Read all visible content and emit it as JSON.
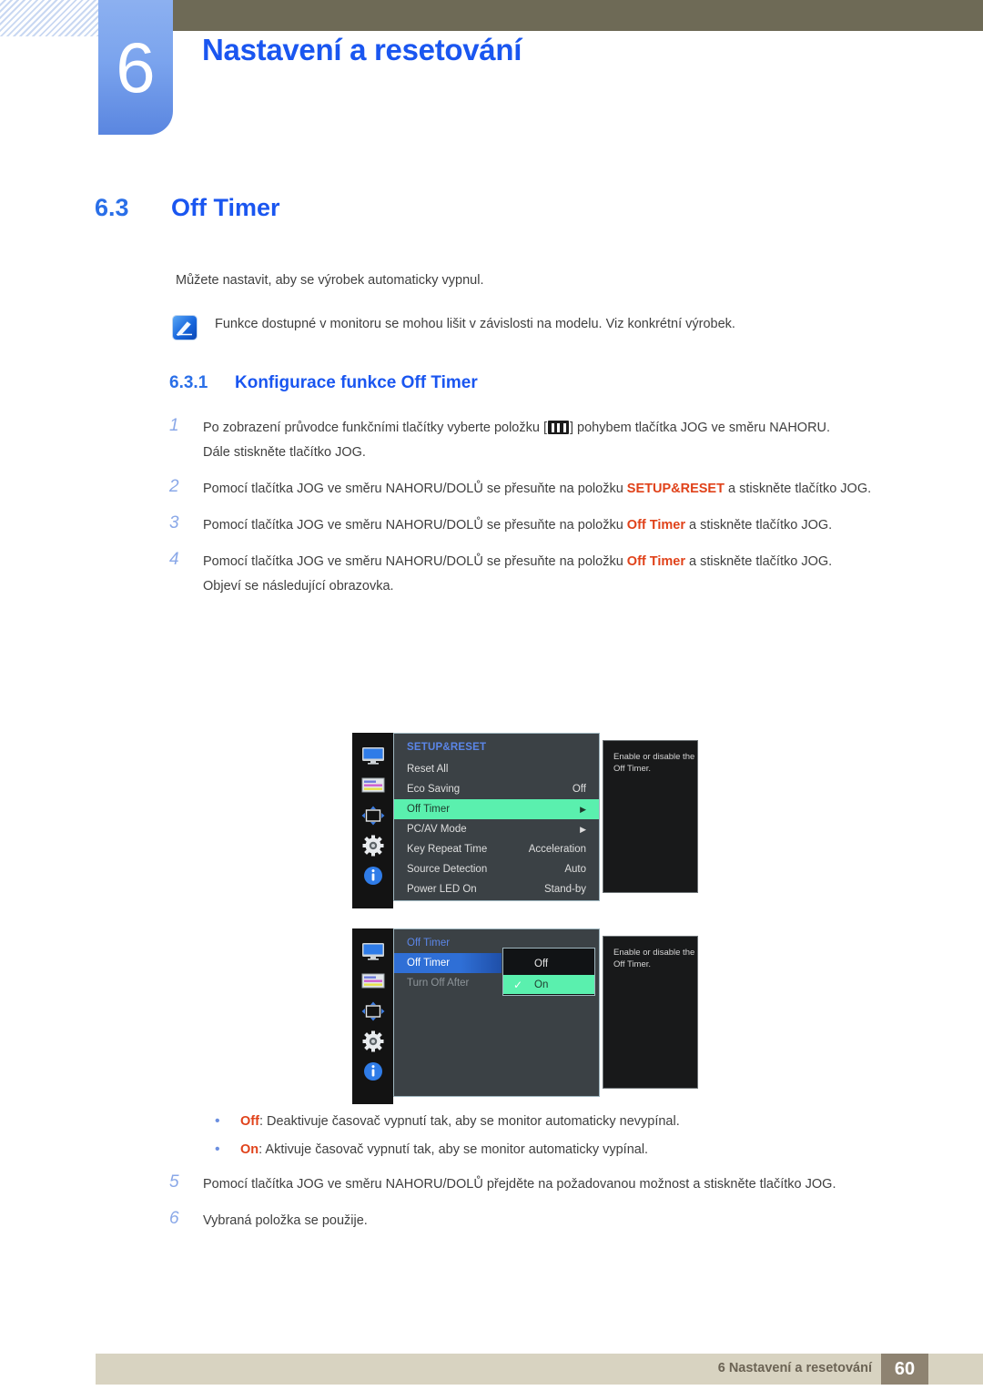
{
  "header": {
    "chapter_number": "6",
    "chapter_title": "Nastaveni a resetovani",
    "chapter_title_display": "Nastavení a resetování"
  },
  "section": {
    "number": "6.3",
    "title": "Off Timer"
  },
  "intro": "Můžete nastavit, aby se výrobek automaticky vypnul.",
  "note": {
    "icon": "note-pen-icon",
    "text": "Funkce dostupné v monitoru se mohou lišit v závislosti na modelu. Viz konkrétní výrobek."
  },
  "subsection": {
    "number": "6.3.1",
    "title": "Konfigurace funkce Off Timer"
  },
  "steps": [
    {
      "number": "1",
      "parts": [
        {
          "t": "Po zobrazení průvodce funkčními tlačítky vyberte položku [",
          "k": "plain"
        },
        {
          "t": "menu-glyph-icon",
          "k": "glyph"
        },
        {
          "t": "] pohybem tlačítka JOG ve směru NAHORU.",
          "k": "plain"
        }
      ],
      "extra": "Dále stiskněte tlačítko JOG."
    },
    {
      "number": "2",
      "parts": [
        {
          "t": "Pomocí tlačítka JOG ve směru NAHORU/DOLŮ se přesuňte na položku ",
          "k": "plain"
        },
        {
          "t": "SETUP&RESET",
          "k": "hl"
        },
        {
          "t": " a stiskněte tlačítko JOG.",
          "k": "plain"
        }
      ],
      "extra": ""
    },
    {
      "number": "3",
      "parts": [
        {
          "t": "Pomocí tlačítka JOG ve směru NAHORU/DOLŮ se přesuňte na položku ",
          "k": "plain"
        },
        {
          "t": "Off Timer",
          "k": "hl"
        },
        {
          "t": " a stiskněte tlačítko JOG.",
          "k": "plain"
        }
      ],
      "extra": ""
    },
    {
      "number": "4",
      "parts": [
        {
          "t": "Pomocí tlačítka JOG ve směru NAHORU/DOLŮ se přesuňte na položku ",
          "k": "plain"
        },
        {
          "t": "Off Timer",
          "k": "hl"
        },
        {
          "t": " a stiskněte tlačítko JOG.",
          "k": "plain"
        }
      ],
      "extra": "Objeví se následující obrazovka."
    }
  ],
  "osd_menu_1": {
    "title": "SETUP&RESET",
    "sidebar_icons": [
      "monitor-icon",
      "picture-list-icon",
      "position-arrows-icon",
      "gear-icon",
      "info-icon"
    ],
    "rows": [
      {
        "label": "Reset All",
        "value": "",
        "arrow": false,
        "selected": false
      },
      {
        "label": "Eco Saving",
        "value": "Off",
        "arrow": false,
        "selected": false
      },
      {
        "label": "Off Timer",
        "value": "",
        "arrow": true,
        "selected": true
      },
      {
        "label": "PC/AV Mode",
        "value": "",
        "arrow": true,
        "selected": false
      },
      {
        "label": "Key Repeat Time",
        "value": "Acceleration",
        "arrow": false,
        "selected": false
      },
      {
        "label": "Source Detection",
        "value": "Auto",
        "arrow": false,
        "selected": false
      },
      {
        "label": "Power LED On",
        "value": "Stand-by",
        "arrow": false,
        "selected": false
      }
    ],
    "description": "Enable or disable the Off Timer."
  },
  "osd_menu_2": {
    "title": "Off Timer",
    "sidebar_icons": [
      "monitor-icon",
      "picture-list-icon",
      "position-arrows-icon",
      "gear-icon",
      "info-icon"
    ],
    "rows": [
      {
        "label": "Off Timer",
        "selected": true,
        "dim": false
      },
      {
        "label": "Turn Off After",
        "selected": false,
        "dim": true
      }
    ],
    "popup": {
      "options": [
        {
          "label": "Off",
          "checked": false
        },
        {
          "label": "On",
          "checked": true
        }
      ],
      "check_glyph": "check-icon"
    },
    "description": "Enable or disable the Off Timer."
  },
  "bullets": [
    {
      "term": "Off",
      "text": ": Deaktivuje časovač vypnutí tak, aby se monitor automaticky nevypínal."
    },
    {
      "term": "On",
      "text": ": Aktivuje časovač vypnutí tak, aby se monitor automaticky vypínal."
    }
  ],
  "steps_after": [
    {
      "number": "5",
      "text": "Pomocí tlačítka JOG ve směru NAHORU/DOLŮ přejděte na požadovanou možnost a stiskněte tlačítko JOG.",
      "extra": ""
    },
    {
      "number": "6",
      "text": "Vybraná položka se použije.",
      "extra": ""
    }
  ],
  "footer": {
    "text": "6 Nastavení a resetování",
    "page": "60"
  },
  "colors": {
    "heading_blue": "#1a56f0",
    "highlight_orange": "#e0421a",
    "header_bar": "#6e6a56",
    "footer_bar": "#d8d3c1",
    "page_box": "#8e8371",
    "osd_green": "#5af0ae",
    "osd_blue": "#2f6fd6"
  }
}
